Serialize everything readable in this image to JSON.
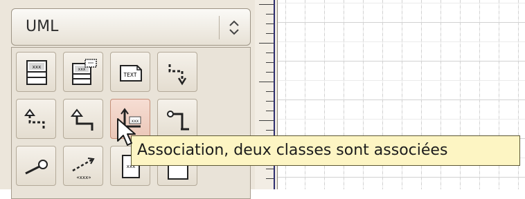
{
  "sidebar": {
    "sheet_selector": {
      "value": "UML",
      "icon": "spin-up-down-icon"
    },
    "tools": [
      {
        "name": "uml-class-tool",
        "icon_text": "xxx"
      },
      {
        "name": "uml-class-template-tool",
        "icon_text": "xxx"
      },
      {
        "name": "uml-note-tool",
        "icon_text": "TEXT"
      },
      {
        "name": "uml-dependency-tool"
      },
      {
        "name": "uml-realizes-tool"
      },
      {
        "name": "uml-generalization-tool"
      },
      {
        "name": "uml-association-tool",
        "icon_text": "xxx",
        "hovered": true
      },
      {
        "name": "uml-implements-tool"
      },
      {
        "name": "uml-lollipop-tool"
      },
      {
        "name": "uml-stereotype-dependency-tool",
        "icon_text": "«xxx»"
      },
      {
        "name": "uml-object-tool",
        "icon_text": "xxx"
      },
      {
        "name": "uml-component-tool"
      }
    ]
  },
  "tooltip": {
    "text": "Association, deux classes sont associées"
  },
  "colors": {
    "panel_bg": "#ece6db",
    "tooltip_bg": "#fdf5c3",
    "hover_tool": "#f6ddd3",
    "grid": "#d2d2d2"
  }
}
